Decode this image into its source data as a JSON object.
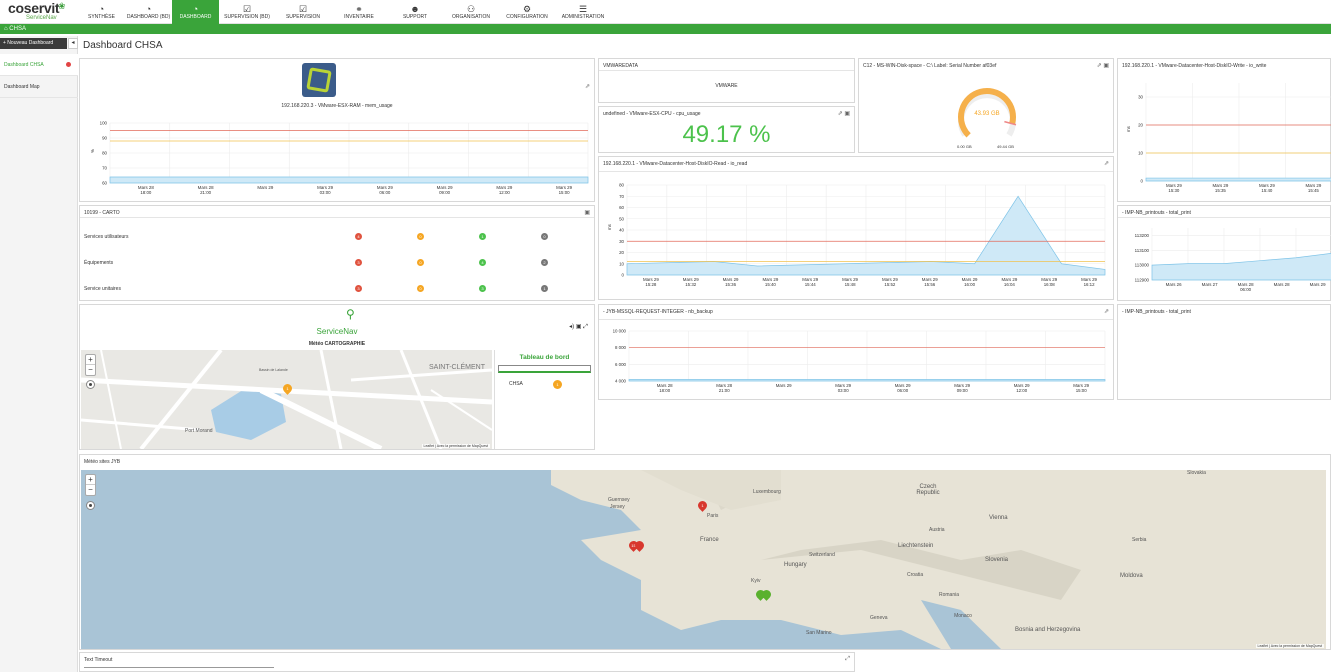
{
  "app": {
    "logo": "coservit",
    "logo_sub": "ServiceNav",
    "breadcrumb": "CHSA"
  },
  "nav": [
    {
      "label": "Synthèse",
      "icon": "gauge-icon"
    },
    {
      "label": "Dashboard (BD)",
      "icon": "gauge-icon"
    },
    {
      "label": "Dashboard",
      "icon": "gauge-icon",
      "active": true
    },
    {
      "label": "Supervision (BD)",
      "icon": "check-icon"
    },
    {
      "label": "Supervision",
      "icon": "check-icon"
    },
    {
      "label": "Inventaire",
      "icon": "sitemap-icon"
    },
    {
      "label": "Support",
      "icon": "support-icon"
    },
    {
      "label": "Organisation",
      "icon": "users-icon"
    },
    {
      "label": "Configuration",
      "icon": "cogs-icon"
    },
    {
      "label": "Administration",
      "icon": "sliders-icon"
    }
  ],
  "sidebar": {
    "new_dashboard": "+ Nouveau Dashboard",
    "collapse": "◂",
    "items": [
      {
        "label": "Dashboard CHSA",
        "active": true
      },
      {
        "label": "Dashboard Map"
      }
    ]
  },
  "page": {
    "title": "Dashboard CHSA"
  },
  "panels": {
    "ram": {
      "title": "192.168.220.3 - VMware-ESX-RAM - mem_usage",
      "ylabel": "%"
    },
    "vmwaredata": {
      "title": "VMWAREDATA",
      "value": "VMWARE"
    },
    "cpu": {
      "title": "undefined - VMware-ESX-CPU - cpu_usage",
      "value": "49.17 %"
    },
    "disk": {
      "title": "C12 - MS-WIN-Disk-space - C:\\ Label:  Serial Number  af03ef",
      "value": "43.93 GB",
      "min": "0.00 GB",
      "max": "49.44 GB"
    },
    "write": {
      "title": "192.168.220.1 - VMware-Datacenter-Host-DiskIO-Write - io_write",
      "ylabel": "ms"
    },
    "read": {
      "title": "192.168.220.1 - VMware-Datacenter-Host-DiskIO-Read - io_read",
      "ylabel": "ms"
    },
    "carto": {
      "title": "10199 - CARTO",
      "rows": [
        {
          "label": "Services utilisateurs",
          "counts": [
            "4",
            "0",
            "1",
            "0"
          ]
        },
        {
          "label": "Équipements",
          "counts": [
            "3",
            "0",
            "4",
            "2"
          ]
        },
        {
          "label": "Service unitaires",
          "counts": [
            "3",
            "0",
            "3",
            "1"
          ]
        }
      ]
    },
    "print1": {
      "title": "- IMP-NB_printouts - total_print"
    },
    "print2": {
      "title": "- IMP-NB_printouts - total_print"
    },
    "sql": {
      "title": "- JYB-MSSQL-REQUEST-INTEGER - nb_backup"
    },
    "map1": {
      "brand": "ServiceNav",
      "caption": "Météo CARTOGRAPHIE",
      "tableau_title": "Tableau de bord",
      "tableau_row": "CHSA",
      "tableau_count": "1",
      "attrib": "Leaflet | Avec la permission de MapQuest",
      "labels": [
        "Port Morand",
        "SAINT-CLÉMENT",
        "Bassin de Lalande"
      ]
    },
    "map2": {
      "caption": "Météo sites JYB",
      "attrib": "Leaflet | Avec la permission de MapQuest",
      "labels": [
        "Paris",
        "France",
        "Luxembourg",
        "Czech Republic",
        "Slovakia",
        "Vienna",
        "Austria",
        "Liechtenstein",
        "Switzerland",
        "Hungary",
        "Slovenia",
        "Croatia",
        "Romania",
        "Moldova",
        "Serbia",
        "Bosnia and Herzegovina",
        "Monaco",
        "San Marino",
        "Geneva",
        "Guernsey",
        "Jersey",
        "Kyiv"
      ]
    },
    "text": {
      "title": "Text Timeout"
    }
  },
  "charts": {
    "ram": {
      "type": "area",
      "x": [
        "Mars 28 18:00",
        "Mars 28 21:00",
        "Mars 29",
        "Mars 29 03:00",
        "Mars 29 06:00",
        "Mars 29 09:00",
        "Mars 29 12:00",
        "Mars 29 15:00"
      ],
      "yticks": [
        100,
        90,
        80,
        70,
        60
      ],
      "ylim": [
        60,
        100
      ],
      "values": [
        64,
        64,
        64,
        64,
        64,
        64,
        64,
        64,
        64
      ],
      "red": 95,
      "yellow": 88
    },
    "write": {
      "type": "area",
      "x": [
        "Mars 29 15:30",
        "Mars 29 15:35",
        "Mars 29 15:40",
        "Mars 29 15:45"
      ],
      "yticks": [
        30,
        20,
        10,
        0
      ],
      "ylim": [
        0,
        35
      ],
      "red": 20,
      "yellow": 10
    },
    "read": {
      "type": "area",
      "x": [
        "Mars 29 15:28",
        "Mars 29 15:32",
        "Mars 29 15:36",
        "Mars 29 15:40",
        "Mars 29 15:44",
        "Mars 29 15:48",
        "Mars 29 15:52",
        "Mars 29 15:56",
        "Mars 29 16:00",
        "Mars 29 16:04",
        "Mars 29 16:08",
        "Mars 29 16:12"
      ],
      "yticks": [
        80,
        70,
        60,
        50,
        40,
        30,
        20,
        10,
        0
      ],
      "ylim": [
        0,
        80
      ],
      "values": [
        10,
        11,
        12,
        8,
        9,
        10,
        11,
        12,
        10,
        70,
        10,
        5
      ],
      "red": 30,
      "yellow": 12
    },
    "print": {
      "type": "area",
      "x": [
        "Mars 26",
        "Mars 27",
        "Mars 28 06:00",
        "Mars 28",
        "Mars 29"
      ],
      "yticks": [
        113200,
        113100,
        113000,
        112900
      ],
      "ylim": [
        112900,
        113250
      ],
      "values": [
        113000,
        113010,
        113010,
        113030,
        113050,
        113080
      ],
      "red": null
    },
    "sql": {
      "type": "area",
      "x": [
        "Mars 28 18:00",
        "Mars 28 21:00",
        "Mars 29",
        "Mars 29 03:00",
        "Mars 29 06:00",
        "Mars 29 09:00",
        "Mars 29 12:00",
        "Mars 29 15:00"
      ],
      "yticks": [
        "10 000",
        "8 000",
        "6 000",
        "4 000"
      ],
      "ylim": [
        4000,
        10000
      ],
      "red": 8000
    }
  },
  "colors": {
    "accent": "#3aa43a",
    "fill": "#cfe9f7",
    "line": "#7fc4e8"
  }
}
